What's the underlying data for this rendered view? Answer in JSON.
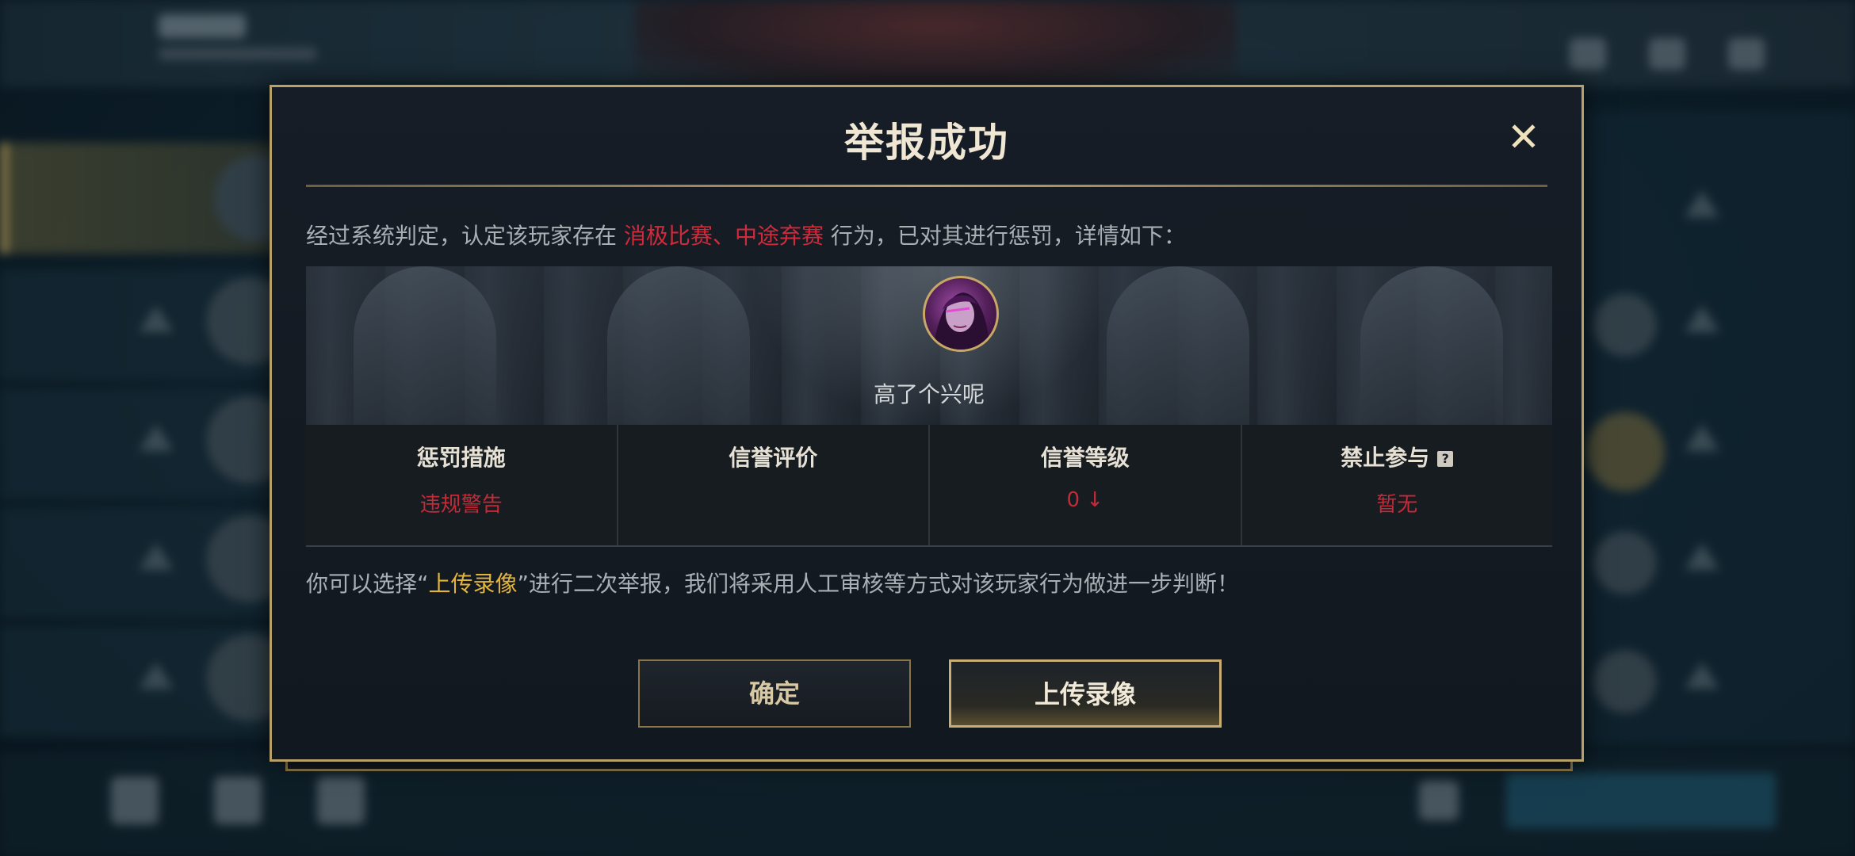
{
  "dialog": {
    "title": "举报成功",
    "close_icon": "close-icon",
    "verdict": {
      "prefix": "经过系统判定，认定该玩家存在 ",
      "behavior1": "消极比赛",
      "separator": "、",
      "behavior2": "中途弃赛",
      "suffix": " 行为，已对其进行惩罚，详情如下："
    },
    "player": {
      "name": "高了个兴呢",
      "avatar_icon": "champion-portrait"
    },
    "stats": [
      {
        "label": "惩罚措施",
        "value": "违规警告"
      },
      {
        "label": "信誉评价",
        "value": ""
      },
      {
        "label": "信誉等级",
        "value": "0 ↓"
      },
      {
        "label": "禁止参与",
        "value": "暂无",
        "help_icon": "?"
      }
    ],
    "followup": {
      "prefix": "你可以选择“",
      "link": "上传录像",
      "suffix": "”进行二次举报，我们将采用人工审核等方式对该玩家行为做进一步判断！"
    },
    "buttons": {
      "confirm": "确定",
      "upload": "上传录像"
    }
  },
  "colors": {
    "accent_gold": "#b8a069",
    "penalty_red": "#c42a38",
    "link_gold": "#e2b43c"
  }
}
